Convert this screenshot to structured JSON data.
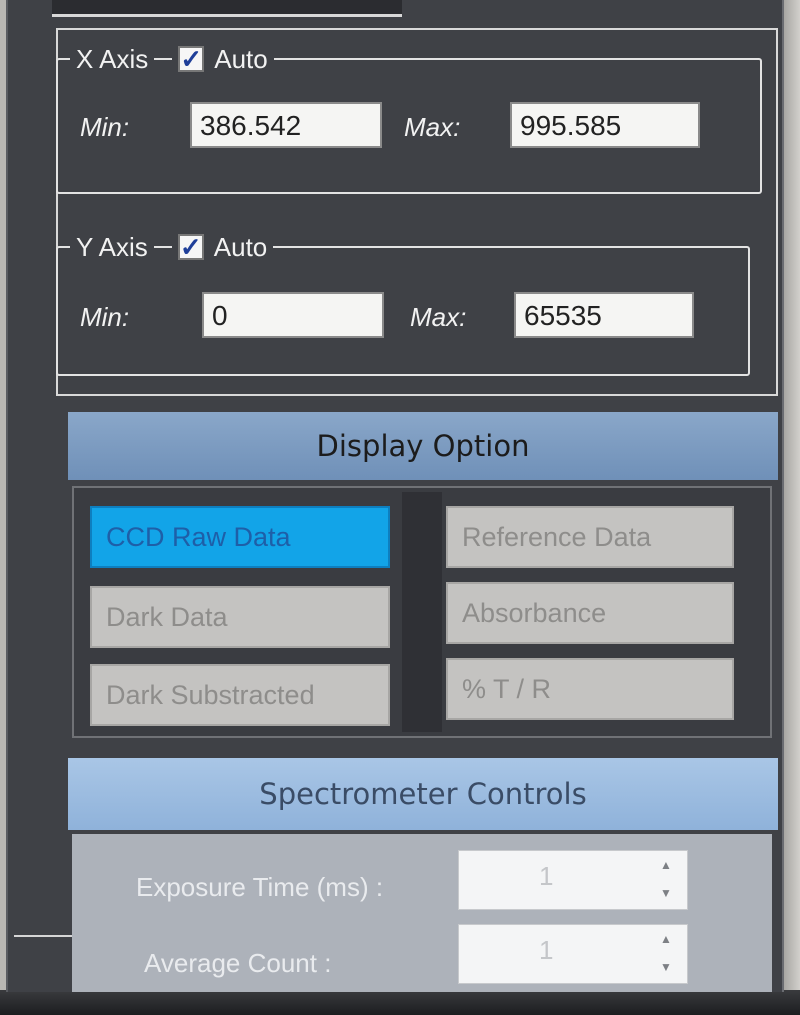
{
  "x_axis": {
    "title": "X Axis",
    "auto_label": "Auto",
    "auto_checked": true,
    "min_label": "Min:",
    "min_value": "386.542",
    "max_label": "Max:",
    "max_value": "995.585"
  },
  "y_axis": {
    "title": "Y Axis",
    "auto_label": "Auto",
    "auto_checked": true,
    "min_label": "Min:",
    "min_value": "0",
    "max_label": "Max:",
    "max_value": "65535"
  },
  "display_option": {
    "title": "Display Option",
    "buttons": [
      {
        "label": "CCD Raw Data",
        "active": true
      },
      {
        "label": "Reference Data",
        "active": false
      },
      {
        "label": "Dark Data",
        "active": false
      },
      {
        "label": "Absorbance",
        "active": false
      },
      {
        "label": "Dark Substracted",
        "active": false
      },
      {
        "label": "% T / R",
        "active": false
      }
    ]
  },
  "spectrometer_controls": {
    "title": "Spectrometer Controls",
    "exposure_label": "Exposure Time (ms) :",
    "exposure_value": "1",
    "average_label": "Average Count :",
    "average_value": "1"
  },
  "icons": {
    "checkmark": "check-icon",
    "spin_up": "spin-up-icon",
    "spin_down": "spin-down-icon"
  },
  "colors": {
    "panel_bg": "#3f4146",
    "header_bg": "#7f9ec4",
    "active_button": "#12a4e8",
    "inactive_button": "#c4c3c1"
  }
}
